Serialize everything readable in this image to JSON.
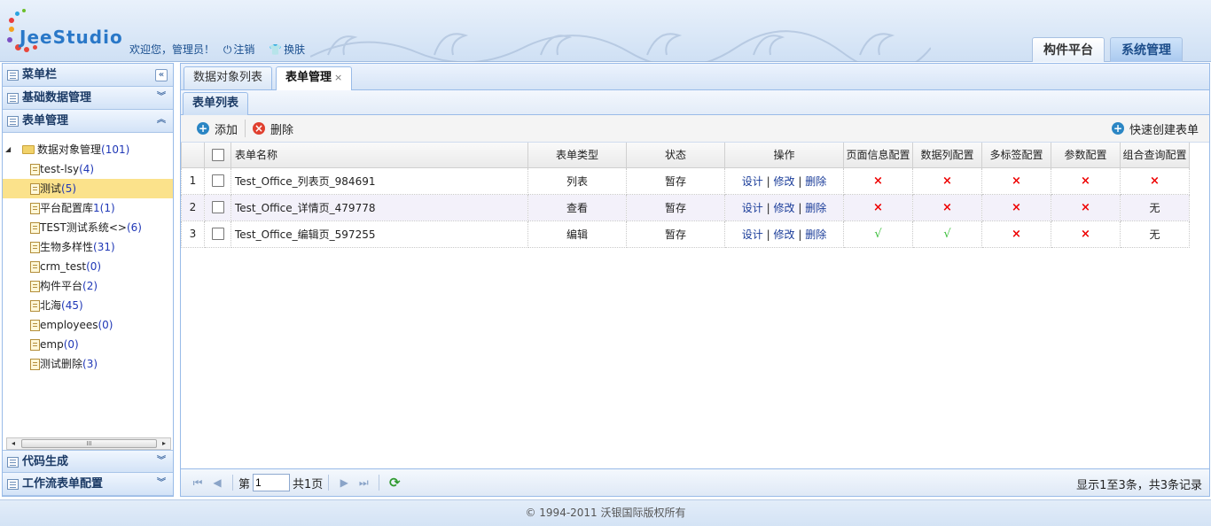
{
  "app": {
    "logo_text": "JeeStudio"
  },
  "header": {
    "welcome": "欢迎您，管理员！",
    "logout": "注销",
    "skin": "换肤",
    "top_tabs": [
      "构件平台",
      "系统管理"
    ]
  },
  "sidebar": {
    "title": "菜单栏",
    "sections": [
      "基础数据管理",
      "表单管理"
    ],
    "bottom_sections": [
      "代码生成",
      "工作流表单配置"
    ],
    "tree": {
      "root_label": "数据对象管理",
      "root_count": "(101)",
      "items": [
        {
          "label": "test-lsy",
          "count": "(4)"
        },
        {
          "label": "测试",
          "count": "(5)"
        },
        {
          "label": "平台配置库",
          "count": "1(1)"
        },
        {
          "label": "TEST测试系统<>",
          "count": "(6)"
        },
        {
          "label": "生物多样性",
          "count": "(31)"
        },
        {
          "label": "crm_test",
          "count": "(0)"
        },
        {
          "label": "构件平台",
          "count": "(2)"
        },
        {
          "label": "北海",
          "count": "(45)"
        },
        {
          "label": "employees",
          "count": "(0)"
        },
        {
          "label": "emp",
          "count": "(0)"
        },
        {
          "label": "测试删除",
          "count": "(3)"
        }
      ]
    },
    "scroll_grip": "III"
  },
  "main": {
    "tabs": [
      {
        "label": "数据对象列表"
      },
      {
        "label": "表单管理",
        "close": "×"
      }
    ],
    "subtab": "表单列表",
    "toolbar": {
      "add": "添加",
      "delete": "删除",
      "quick_create": "快速创建表单"
    },
    "grid": {
      "columns": [
        "表单名称",
        "表单类型",
        "状态",
        "操作",
        "页面信息配置",
        "数据列配置",
        "多标签配置",
        "参数配置",
        "组合查询配置"
      ],
      "rows": [
        {
          "num": "1",
          "name": "Test_Office_列表页_984691",
          "type": "列表",
          "status": "暂存",
          "ops": [
            "设计",
            "修改",
            "删除"
          ],
          "page_cfg": "×",
          "col_cfg": "×",
          "tab_cfg": "×",
          "param_cfg": "×",
          "query_cfg": "×"
        },
        {
          "num": "2",
          "name": "Test_Office_详情页_479778",
          "type": "查看",
          "status": "暂存",
          "ops": [
            "设计",
            "修改",
            "删除"
          ],
          "page_cfg": "×",
          "col_cfg": "×",
          "tab_cfg": "×",
          "param_cfg": "×",
          "query_cfg": "无"
        },
        {
          "num": "3",
          "name": "Test_Office_编辑页_597255",
          "type": "编辑",
          "status": "暂存",
          "ops": [
            "设计",
            "修改",
            "删除"
          ],
          "page_cfg": "√",
          "col_cfg": "√",
          "tab_cfg": "×",
          "param_cfg": "×",
          "query_cfg": "无"
        }
      ],
      "op_sep": "|"
    },
    "pager": {
      "page_prefix": "第",
      "page_value": "1",
      "page_total": "共1页",
      "info": "显示1至3条，共3条记录"
    }
  },
  "footer": {
    "copyright": "© 1994-2011 沃银国际版权所有"
  },
  "colors": {
    "accent": "#99bbe8",
    "selected": "#fbe28b",
    "link": "#1a3c99",
    "cross": "#e00000",
    "check": "#3bbf3b"
  }
}
